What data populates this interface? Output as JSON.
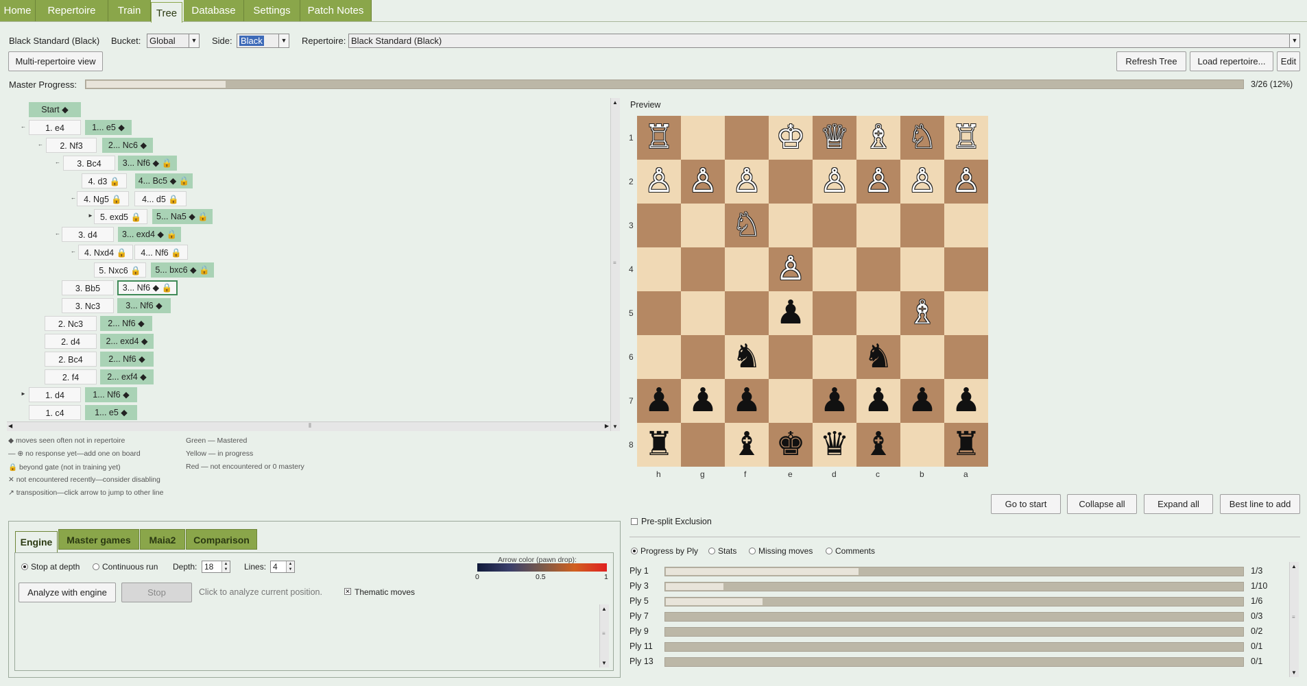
{
  "menu": {
    "tabs": [
      "Home",
      "Repertoire",
      "Train",
      "Tree",
      "Database",
      "Settings",
      "Patch Notes"
    ]
  },
  "header": {
    "repertoire_name": "Black Standard (Black)",
    "bucket_label": "Bucket:",
    "bucket_value": "Global",
    "side_label": "Side:",
    "side_value": "Black",
    "repertoire_label": "Repertoire:",
    "repertoire_value": "Black Standard (Black)",
    "multi_view": "Multi-repertoire view",
    "refresh": "Refresh Tree",
    "load": "Load repertoire...",
    "edit": "Edit",
    "master_progress_label": "Master Progress:",
    "master_progress_text": "3/26 (12%)",
    "master_progress_fraction": 0.12
  },
  "tree": {
    "nodes": [
      {
        "text": "Start ◆",
        "kind": "b"
      },
      {
        "text": "1. e4",
        "kind": "w"
      },
      {
        "text": "1... e5 ◆",
        "kind": "b"
      },
      {
        "text": "2. Nf3",
        "kind": "w"
      },
      {
        "text": "2... Nc6 ◆",
        "kind": "b"
      },
      {
        "text": "3. Bc4",
        "kind": "w"
      },
      {
        "text": "3... Nf6 ◆ 🔒",
        "kind": "b"
      },
      {
        "text": "4. d3 🔒",
        "kind": "w"
      },
      {
        "text": "4... Bc5 ◆ 🔒",
        "kind": "b"
      },
      {
        "text": "4. Ng5 🔒",
        "kind": "w"
      },
      {
        "text": "4... d5 🔒",
        "kind": "w"
      },
      {
        "text": "5. exd5 🔒",
        "kind": "w"
      },
      {
        "text": "5... Na5 ◆ 🔒",
        "kind": "b"
      },
      {
        "text": "3. d4",
        "kind": "w"
      },
      {
        "text": "3... exd4 ◆ 🔒",
        "kind": "b"
      },
      {
        "text": "4. Nxd4 🔒",
        "kind": "w"
      },
      {
        "text": "4... Nf6 🔒",
        "kind": "w"
      },
      {
        "text": "5. Nxc6 🔒",
        "kind": "w"
      },
      {
        "text": "5... bxc6 ◆ 🔒",
        "kind": "b"
      },
      {
        "text": "3. Bb5",
        "kind": "w"
      },
      {
        "text": "3... Nf6 ◆ 🔒",
        "kind": "sel"
      },
      {
        "text": "3. Nc3",
        "kind": "w"
      },
      {
        "text": "3... Nf6 ◆",
        "kind": "b"
      },
      {
        "text": "2. Nc3",
        "kind": "w"
      },
      {
        "text": "2... Nf6 ◆",
        "kind": "b"
      },
      {
        "text": "2. d4",
        "kind": "w"
      },
      {
        "text": "2... exd4 ◆",
        "kind": "b"
      },
      {
        "text": "2. Bc4",
        "kind": "w"
      },
      {
        "text": "2... Nf6 ◆",
        "kind": "b"
      },
      {
        "text": "2. f4",
        "kind": "w"
      },
      {
        "text": "2... exf4 ◆",
        "kind": "b"
      },
      {
        "text": "1. d4",
        "kind": "w"
      },
      {
        "text": "1... Nf6 ◆",
        "kind": "b"
      },
      {
        "text": "1. c4",
        "kind": "w"
      },
      {
        "text": "1... e5 ◆",
        "kind": "b"
      }
    ],
    "legend": [
      "◆ moves seen often not in repertoire",
      "— ⊕  no response yet—add one on board",
      "🔒 beyond gate (not in training yet)",
      "✕ not encountered recently—consider disabling",
      "↗ transposition—click arrow to jump to other line"
    ],
    "legend2": [
      "Green — Mastered",
      "Yellow — in progress",
      "Red — not encountered or 0 mastery"
    ]
  },
  "board": {
    "preview_label": "Preview",
    "ranks": [
      "1",
      "2",
      "3",
      "4",
      "5",
      "6",
      "7",
      "8"
    ],
    "files": [
      "h",
      "g",
      "f",
      "e",
      "d",
      "c",
      "b",
      "a"
    ],
    "rows": [
      [
        "♖",
        "",
        "",
        "♔",
        "♕",
        "♗",
        "♘",
        "♖"
      ],
      [
        "♙",
        "♙",
        "♙",
        "",
        "♙",
        "♙",
        "♙",
        "♙"
      ],
      [
        "",
        "",
        "♘",
        "",
        "",
        "",
        "",
        ""
      ],
      [
        "",
        "",
        "",
        "♙",
        "",
        "",
        "",
        ""
      ],
      [
        "",
        "",
        "",
        "♟",
        "",
        "",
        "♗",
        ""
      ],
      [
        "",
        "",
        "♞",
        "",
        "",
        "♞",
        "",
        ""
      ],
      [
        "♟",
        "♟",
        "♟",
        "",
        "♟",
        "♟",
        "♟",
        "♟"
      ],
      [
        "♜",
        "",
        "♝",
        "♚",
        "♛",
        "♝",
        "",
        "♜"
      ]
    ],
    "buttons": {
      "start": "Go to start",
      "collapse": "Collapse all",
      "expand": "Expand all",
      "best": "Best line to add"
    }
  },
  "presplit": "Pre-split Exclusion",
  "progress": {
    "modes": [
      "Progress by Ply",
      "Stats",
      "Missing moves",
      "Comments"
    ],
    "rows": [
      {
        "label": "Ply 1",
        "text": "1/3",
        "fraction": 0.333
      },
      {
        "label": "Ply 3",
        "text": "1/10",
        "fraction": 0.1
      },
      {
        "label": "Ply 5",
        "text": "1/6",
        "fraction": 0.167
      },
      {
        "label": "Ply 7",
        "text": "0/3",
        "fraction": 0
      },
      {
        "label": "Ply 9",
        "text": "0/2",
        "fraction": 0
      },
      {
        "label": "Ply 11",
        "text": "0/1",
        "fraction": 0
      },
      {
        "label": "Ply 13",
        "text": "0/1",
        "fraction": 0
      }
    ]
  },
  "engine": {
    "tabs": [
      "Engine",
      "Master games",
      "Maia2",
      "Comparison"
    ],
    "stop_at_depth": "Stop at depth",
    "continuous": "Continuous run",
    "depth_label": "Depth:",
    "depth": "18",
    "lines_label": "Lines:",
    "lines": "4",
    "arrow_title": "Arrow color (pawn drop):",
    "arrow_ticks": [
      "0",
      "0.5",
      "1"
    ],
    "analyze": "Analyze with engine",
    "stop": "Stop",
    "hint": "Click to analyze current position.",
    "thematic": "Thematic moves"
  }
}
